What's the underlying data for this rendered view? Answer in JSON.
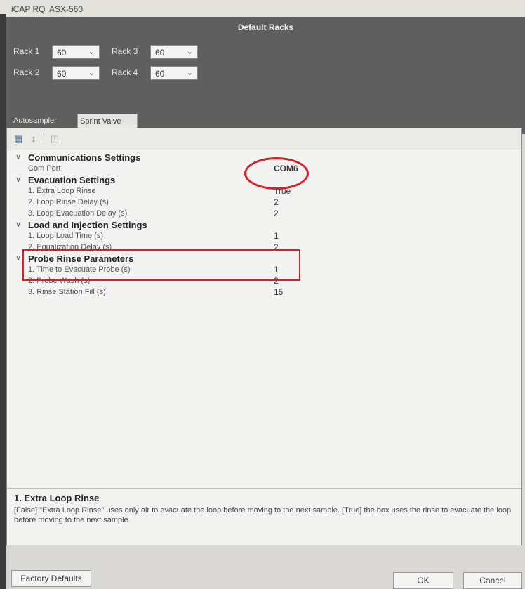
{
  "titlebar": {
    "app": "iCAP RQ",
    "device": "ASX-560"
  },
  "default_racks": {
    "title": "Default Racks",
    "racks": [
      {
        "label": "Rack 1",
        "value": "60"
      },
      {
        "label": "Rack 2",
        "value": "60"
      },
      {
        "label": "Rack 3",
        "value": "60"
      },
      {
        "label": "Rack 4",
        "value": "60"
      }
    ]
  },
  "tabs": {
    "autosampler": "Autosampler",
    "sprint_valve": "Sprint Valve",
    "selected": "Sprint Valve"
  },
  "toolbar": {
    "icons": [
      "categorized-view-icon",
      "alphabetical-sort-icon",
      "property-pages-icon"
    ]
  },
  "property_grid": {
    "communications": {
      "title": "Communications Settings",
      "com_port_label": "Com Port",
      "com_port_value": "COM6"
    },
    "evacuation": {
      "title": "Evacuation Settings",
      "items": [
        {
          "label": "1. Extra Loop Rinse",
          "value": "True"
        },
        {
          "label": "2. Loop Rinse Delay (s)",
          "value": "2"
        },
        {
          "label": "3. Loop Evacuation Delay (s)",
          "value": "2"
        }
      ]
    },
    "load_injection": {
      "title": "Load and Injection Settings",
      "items": [
        {
          "label": "1. Loop Load Time (s)",
          "value": "1"
        },
        {
          "label": "2. Equalization Delay (s)",
          "value": "2"
        }
      ]
    },
    "probe_rinse": {
      "title": "Probe Rinse Parameters",
      "items": [
        {
          "label": "1. Time to Evacuate Probe (s)",
          "value": "1"
        },
        {
          "label": "2. Probe Wash (s)",
          "value": "2"
        },
        {
          "label": "3. Rinse Station Fill (s)",
          "value": "15"
        }
      ]
    }
  },
  "description": {
    "title": "1. Extra Loop Rinse",
    "text": "[False] \"Extra Loop Rinse\" uses only air to evacuate the loop before moving to the next sample. [True] the box uses the rinse to evacuate the loop before moving to the next sample."
  },
  "buttons": {
    "factory_defaults": "Factory Defaults",
    "ok": "OK",
    "cancel": "Cancel"
  },
  "annotation_color": "#d81f26"
}
